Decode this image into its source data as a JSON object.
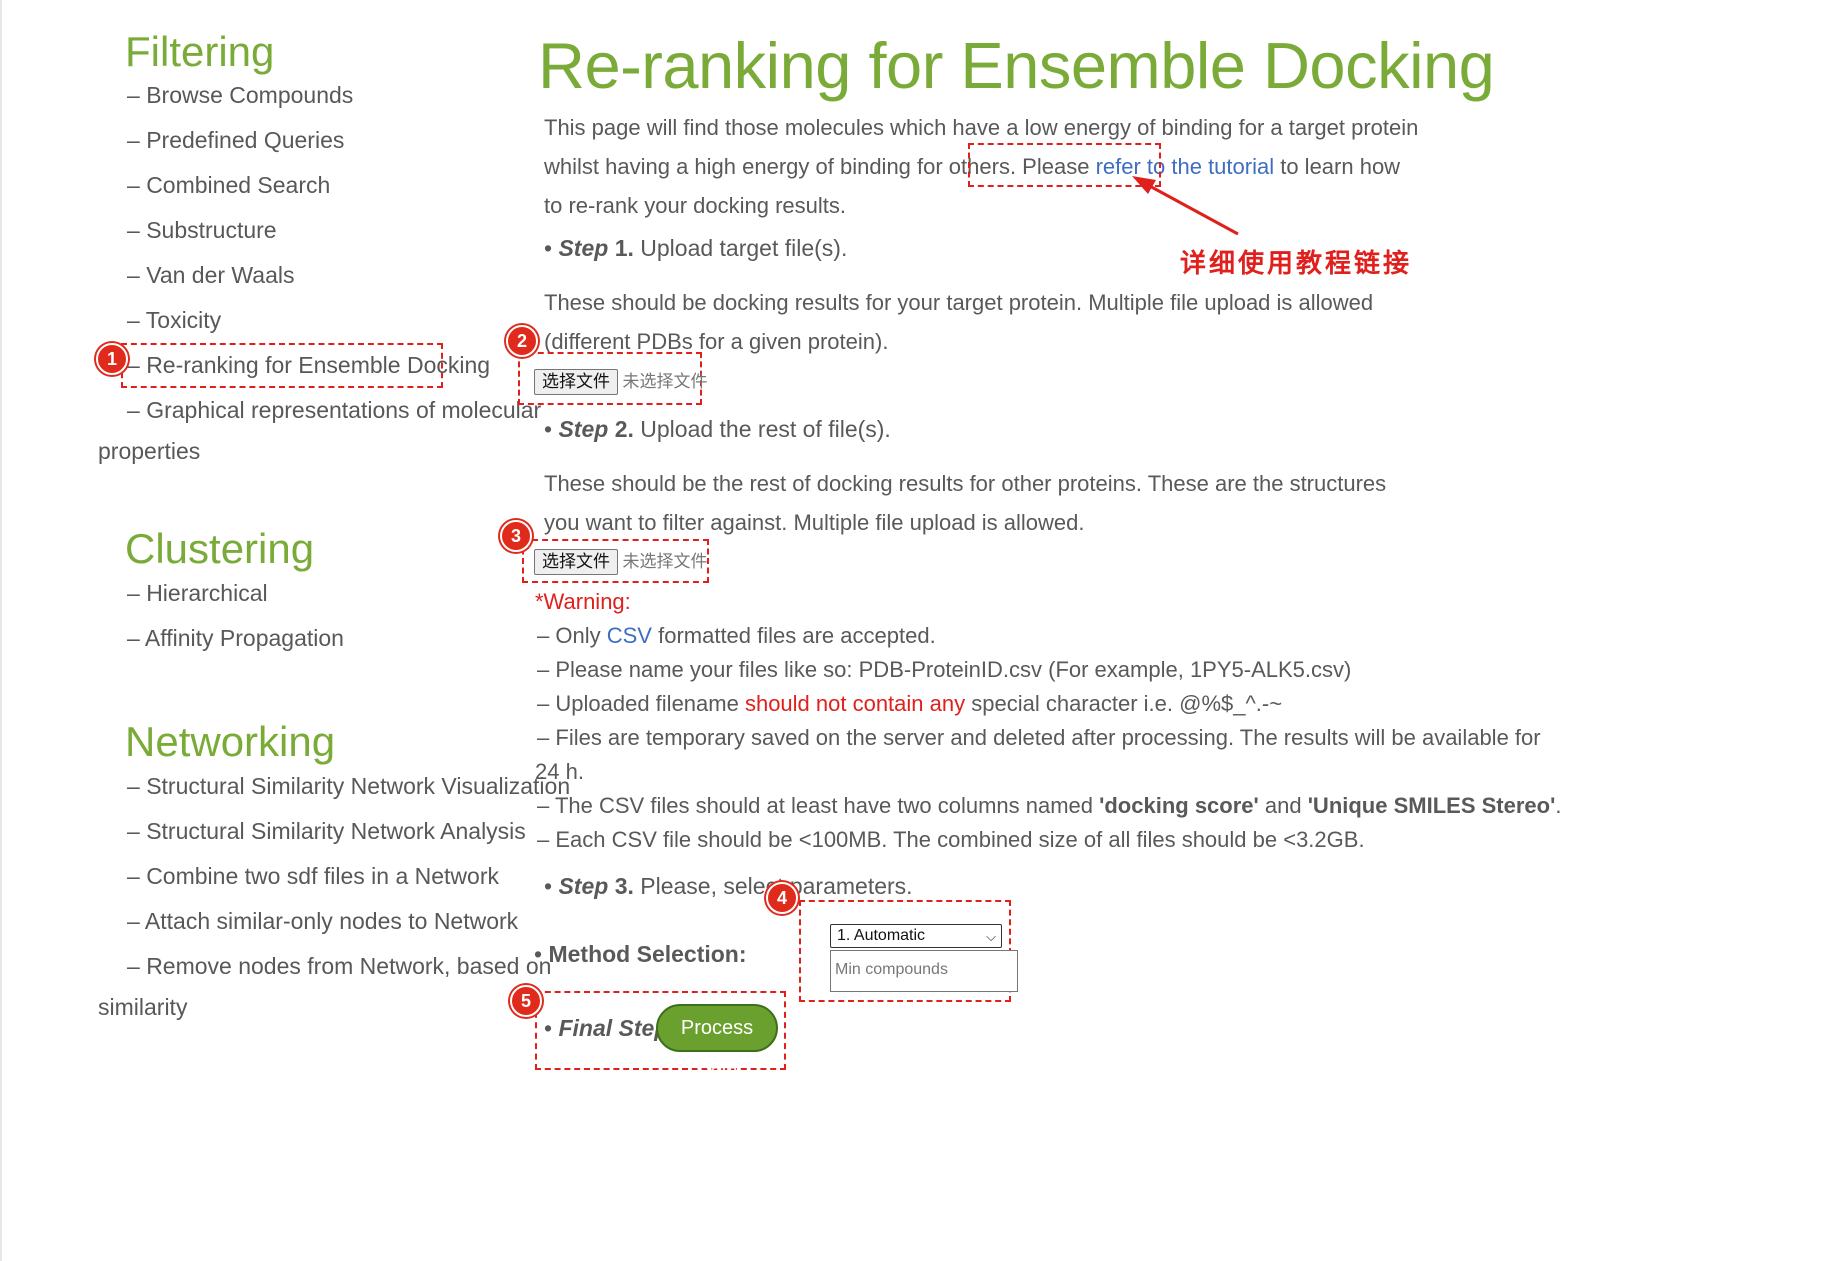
{
  "sidebar": {
    "filtering": {
      "title": "Filtering",
      "items": [
        "Browse Compounds",
        "Predefined Queries",
        "Combined Search",
        "Substructure",
        "Van der Waals",
        "Toxicity",
        "Re-ranking for Ensemble Docking"
      ],
      "graph_item_line1": "Graphical representations of molecular",
      "graph_item_line2": "properties"
    },
    "clustering": {
      "title": "Clustering",
      "items": [
        "Hierarchical",
        "Affinity Propagation"
      ]
    },
    "networking": {
      "title": "Networking",
      "items": [
        "Structural Similarity Network Visualization",
        "Structural Similarity Network Analysis",
        "Combine two sdf files in a Network",
        "Attach similar-only nodes to Network"
      ],
      "remove_line1": "Remove nodes from Network, based on",
      "remove_line2": "similarity"
    },
    "dash": "–"
  },
  "main": {
    "title": "Re-ranking for Ensemble Docking",
    "intro_before": "This page will find those molecules which have a low energy of binding for a target protein whilst having a high energy of binding for others. Please ",
    "intro_link": "refer to the tutorial",
    "intro_after": " to learn how to re-rank your docking results.",
    "step_word": "Step",
    "step1_num": "1.",
    "step1_text": "Upload target file(s).",
    "step1_desc": "These should be docking results for your target protein. Multiple file upload is allowed (different PDBs for a given protein).",
    "file_button": "选择文件",
    "no_file": "未选择文件",
    "step2_num": "2.",
    "step2_text": "Upload the rest of file(s).",
    "step2_desc": "These should be the rest of docking results for other proteins. These are the structures you want to filter against. Multiple file upload is allowed.",
    "warning": {
      "title": "*Warning:",
      "line1_a": "Only ",
      "line1_link": "CSV",
      "line1_b": " formatted files are accepted.",
      "line2": "Please name your files like so: PDB-ProteinID.csv (For example, 1PY5-ALK5.csv)",
      "line3_a": "Uploaded filename ",
      "line3_red": "should not contain any",
      "line3_b": " special character i.e. @%$_^.-~",
      "line4_a": "Files are temporary saved on the server and deleted after processing. The results will be available for",
      "line4_b": "24 h.",
      "line5_a": "The CSV files should at least have two columns named ",
      "line5_b1": "'docking score'",
      "line5_and": " and ",
      "line5_b2": "'Unique SMILES Stereo'",
      "line5_end": ".",
      "line6": "Each CSV file should be <100MB. The combined size of all files should be <3.2GB."
    },
    "step3_num": "3.",
    "step3_text": "Please, select parameters.",
    "method_label": "Method Selection:",
    "method_selected": "1. Automatic",
    "min_compounds_placeholder": "Min compounds",
    "final_step": "Final Step.",
    "process_button": "Process Data",
    "bullet": "•",
    "dash": "–"
  },
  "annotations": {
    "tutorial_note": "详细使用教程链接",
    "badges": [
      "1",
      "2",
      "3",
      "4",
      "5"
    ],
    "color": "#e0201c"
  },
  "colors": {
    "accent_green": "#7aab38",
    "link_blue": "#3f6ec0",
    "warning_red": "#e0201c",
    "button_green": "#6aa02e"
  }
}
